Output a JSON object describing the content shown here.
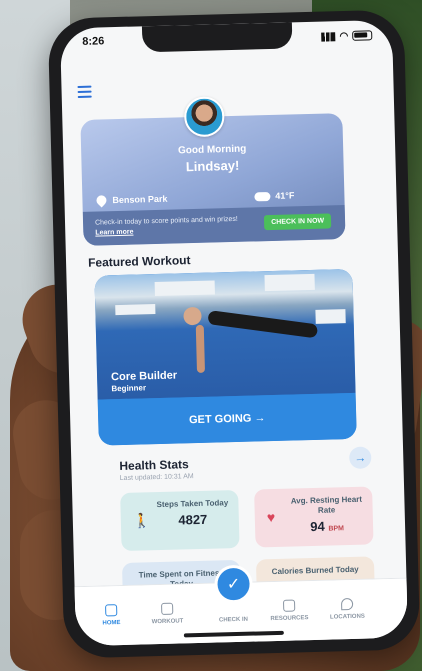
{
  "status_bar": {
    "time": "8:26"
  },
  "header": {
    "greeting": "Good Morning",
    "user_name": "Lindsay!",
    "location": "Benson Park",
    "temperature": "41°F",
    "checkin_prompt": "Check-in today to score points and win prizes!",
    "learn_more": "Learn more",
    "checkin_button": "CHECK IN NOW"
  },
  "featured": {
    "section_title": "Featured Workout",
    "workout_name": "Core Builder",
    "workout_level": "Beginner",
    "cta": "GET GOING →"
  },
  "health": {
    "section_title": "Health Stats",
    "last_updated": "Last updated: 10:31 AM",
    "cards": [
      {
        "label": "Steps Taken Today",
        "value": "4827",
        "unit": "",
        "color": "#d6ecec"
      },
      {
        "label": "Avg. Resting Heart Rate",
        "value": "94",
        "unit": "BPM",
        "color": "#f6dde2"
      },
      {
        "label": "Time Spent on Fitness Today",
        "value": "",
        "unit": "",
        "color": "#dbe7f4"
      },
      {
        "label": "Calories Burned Today",
        "value": "",
        "unit": "",
        "color": "#f3e7dc"
      }
    ]
  },
  "tabbar": {
    "tabs": [
      {
        "label": "HOME",
        "active": true
      },
      {
        "label": "WORKOUT",
        "active": false
      },
      {
        "label": "CHECK IN",
        "active": false
      },
      {
        "label": "RESOURCES",
        "active": false
      },
      {
        "label": "LOCATIONS",
        "active": false
      }
    ]
  },
  "colors": {
    "primary": "#2f89e0",
    "success": "#4bbf5a"
  }
}
